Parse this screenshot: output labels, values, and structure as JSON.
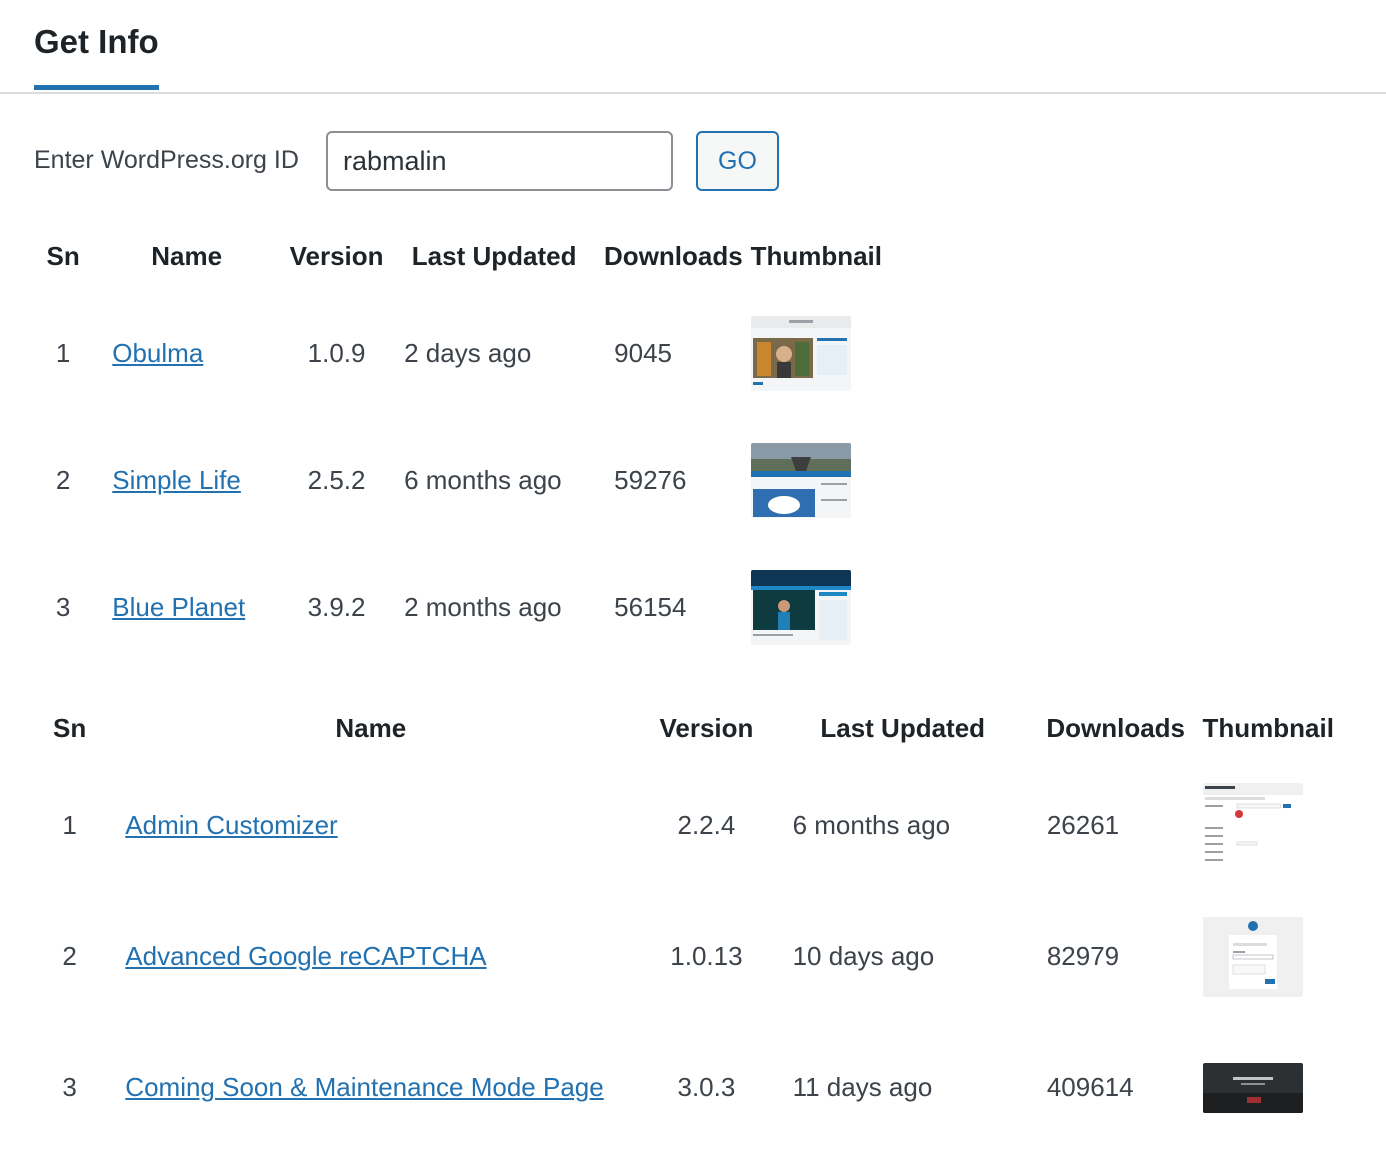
{
  "tabs": {
    "active_label": "Get Info"
  },
  "form": {
    "label": "Enter WordPress.org ID",
    "input_value": "rabmalin",
    "button_label": "GO"
  },
  "themes_table": {
    "headers": {
      "sn": "Sn",
      "name": "Name",
      "version": "Version",
      "last_updated": "Last Updated",
      "downloads": "Downloads",
      "thumbnail": "Thumbnail"
    },
    "rows": [
      {
        "sn": "1",
        "name": "Obulma",
        "version": "1.0.9",
        "last_updated": "2 days ago",
        "downloads": "9045"
      },
      {
        "sn": "2",
        "name": "Simple Life",
        "version": "2.5.2",
        "last_updated": "6 months ago",
        "downloads": "59276"
      },
      {
        "sn": "3",
        "name": "Blue Planet",
        "version": "3.9.2",
        "last_updated": "2 months ago",
        "downloads": "56154"
      }
    ]
  },
  "plugins_table": {
    "headers": {
      "sn": "Sn",
      "name": "Name",
      "version": "Version",
      "last_updated": "Last Updated",
      "downloads": "Downloads",
      "thumbnail": "Thumbnail"
    },
    "rows": [
      {
        "sn": "1",
        "name": "Admin Customizer",
        "version": "2.2.4",
        "last_updated": "6 months ago",
        "downloads": "26261"
      },
      {
        "sn": "2",
        "name": "Advanced Google reCAPTCHA",
        "version": "1.0.13",
        "last_updated": "10 days ago",
        "downloads": "82979"
      },
      {
        "sn": "3",
        "name": "Coming Soon & Maintenance Mode Page",
        "version": "3.0.3",
        "last_updated": "11 days ago",
        "downloads": "409614"
      }
    ]
  },
  "colors": {
    "link": "#2271b1",
    "tab_underline": "#2271b1",
    "heading": "#1d2327",
    "text": "#3c434a"
  }
}
